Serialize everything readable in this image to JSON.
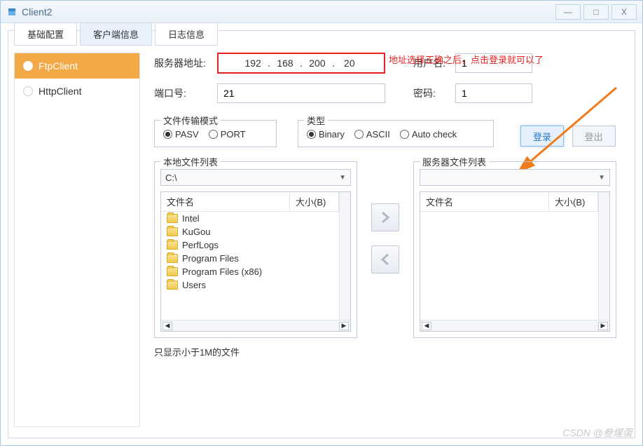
{
  "window": {
    "title": "Client2"
  },
  "winbtns": {
    "min": "—",
    "max": "□",
    "close": "X"
  },
  "tabs": [
    {
      "label": "基础配置",
      "active": false
    },
    {
      "label": "客户端信息",
      "active": true
    },
    {
      "label": "日志信息",
      "active": false
    }
  ],
  "annotation": "地址选择正确之后，点击登录就可以了",
  "sidebar": {
    "items": [
      {
        "label": "FtpClient",
        "active": true
      },
      {
        "label": "HttpClient",
        "active": false
      }
    ]
  },
  "form": {
    "server_label": "服务器地址:",
    "ip": {
      "a": "192",
      "b": "168",
      "c": "200",
      "d": "20"
    },
    "port_label": "端口号:",
    "port_value": "21",
    "user_label": "用户名:",
    "user_value": "1",
    "pass_label": "密码:",
    "pass_value": "1"
  },
  "transfer_mode": {
    "title": "文件传输模式",
    "options": [
      {
        "label": "PASV",
        "checked": true
      },
      {
        "label": "PORT",
        "checked": false
      }
    ]
  },
  "type_mode": {
    "title": "类型",
    "options": [
      {
        "label": "Binary",
        "checked": true
      },
      {
        "label": "ASCII",
        "checked": false
      },
      {
        "label": "Auto check",
        "checked": false
      }
    ]
  },
  "buttons": {
    "login": "登录",
    "logout": "登出"
  },
  "local_panel": {
    "title": "本地文件列表",
    "combo": "C:\\",
    "col_name": "文件名",
    "col_size": "大小(B)",
    "items": [
      {
        "name": "Intel"
      },
      {
        "name": "KuGou"
      },
      {
        "name": "PerfLogs"
      },
      {
        "name": "Program Files"
      },
      {
        "name": "Program Files (x86)"
      },
      {
        "name": "Users"
      }
    ]
  },
  "server_panel": {
    "title": "服务器文件列表",
    "combo": "",
    "col_name": "文件名",
    "col_size": "大小(B)",
    "items": []
  },
  "footer_note": "只显示小于1M的文件",
  "watermark": "CSDN @叁煋蛋"
}
